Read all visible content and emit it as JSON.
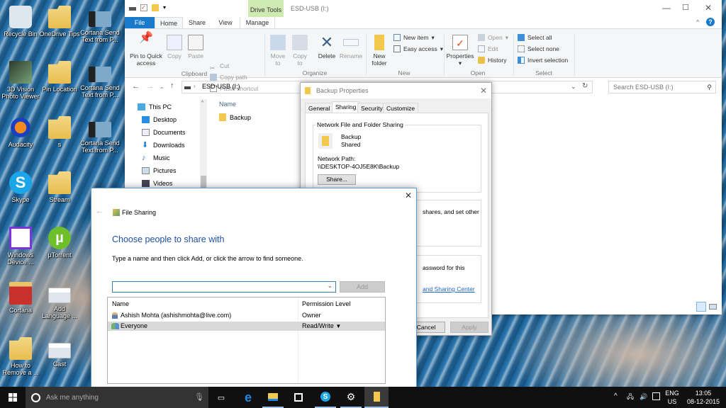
{
  "desktop": {
    "icons": [
      {
        "label": "Recycle Bin",
        "icon": "recycle-bin-icon"
      },
      {
        "label": "OneDrive Tips",
        "icon": "folder-icon"
      },
      {
        "label": "Cortana Send Text from P...",
        "icon": "screenshot-icon"
      },
      {
        "label": "3D Vision Photo Viewer",
        "icon": "3d-vision-icon"
      },
      {
        "label": "Pin Location",
        "icon": "folder-icon"
      },
      {
        "label": "Cortana Send Text from P...",
        "icon": "screenshot-icon"
      },
      {
        "label": "Audacity",
        "icon": "audacity-icon"
      },
      {
        "label": "s",
        "icon": "folder-icon"
      },
      {
        "label": "Cortana Send Text from P...",
        "icon": "screenshot-icon"
      },
      {
        "label": "Skype",
        "icon": "skype-icon"
      },
      {
        "label": "Stream",
        "icon": "folder-icon"
      },
      {
        "label": "Windows Device ...",
        "icon": "windows-device-icon"
      },
      {
        "label": "µTorrent",
        "icon": "utorrent-icon"
      },
      {
        "label": "Cortana",
        "icon": "cortana-folder-icon"
      },
      {
        "label": "Add Language ...",
        "icon": "screenshot-icon"
      },
      {
        "label": "How to Remove a ...",
        "icon": "folder-icon"
      },
      {
        "label": "Cast",
        "icon": "screenshot-icon"
      }
    ]
  },
  "explorer": {
    "title": "ESD-USB (I:)",
    "context_tab": "Drive Tools",
    "tabs": [
      "File",
      "Home",
      "Share",
      "View",
      "Manage"
    ],
    "active_tab": "Home",
    "ribbon": {
      "clipboard": {
        "group": "Clipboard",
        "pin": "Pin to Quick access",
        "copy": "Copy",
        "paste": "Paste",
        "cut": "Cut",
        "copy_path": "Copy path",
        "paste_shortcut": "Paste shortcut"
      },
      "organize": {
        "group": "Organize",
        "move_to": "Move to",
        "copy_to": "Copy to",
        "delete": "Delete",
        "rename": "Rename"
      },
      "new": {
        "group": "New",
        "new_folder": "New folder",
        "new_item": "New item",
        "easy_access": "Easy access"
      },
      "open": {
        "group": "Open",
        "properties": "Properties",
        "open": "Open",
        "edit": "Edit",
        "history": "History"
      },
      "select": {
        "group": "Select",
        "select_all": "Select all",
        "select_none": "Select none",
        "invert": "Invert selection"
      }
    },
    "address": {
      "path": "ESD-USB (I:)",
      "search_placeholder": "Search ESD-USB (I:)"
    },
    "nav": [
      "This PC",
      "Desktop",
      "Documents",
      "Downloads",
      "Music",
      "Pictures",
      "Videos"
    ],
    "column_name": "Name",
    "files": [
      {
        "name": "Backup"
      }
    ]
  },
  "properties": {
    "title": "Backup Properties",
    "tabs": [
      "General",
      "Sharing",
      "Security",
      "Customize"
    ],
    "active_tab": "Sharing",
    "section_title": "Network File and Folder Sharing",
    "folder_name": "Backup",
    "folder_status": "Shared",
    "network_path_label": "Network Path:",
    "network_path": "\\\\DESKTOP-4OJ5E8K\\Backup",
    "share_button": "Share...",
    "advanced_text_fragment": "shares, and set other",
    "password_text_fragment": "assword for this",
    "link_fragment": "and Sharing Center",
    "cancel": "Cancel",
    "apply": "Apply"
  },
  "file_sharing": {
    "title": "File Sharing",
    "heading": "Choose people to share with",
    "instruction": "Type a name and then click Add, or click the arrow to find someone.",
    "input_value": "",
    "add_button": "Add",
    "columns": [
      "Name",
      "Permission Level"
    ],
    "rows": [
      {
        "name": "Ashish Mohta (ashishmohta@live.com)",
        "permission": "Owner",
        "selected": false
      },
      {
        "name": "Everyone",
        "permission": "Read/Write",
        "selected": true
      }
    ]
  },
  "taskbar": {
    "search_placeholder": "Ask me anything",
    "apps": [
      "task-view",
      "edge",
      "file-explorer",
      "store",
      "skype",
      "settings",
      "explorer-window"
    ],
    "language": "ENG",
    "region": "US",
    "time": "13:05",
    "date": "08-12-2015"
  },
  "colors": {
    "accent": "#1979ca",
    "heading_blue": "#1e50a2",
    "drive_tools": "#cfe9b2"
  }
}
